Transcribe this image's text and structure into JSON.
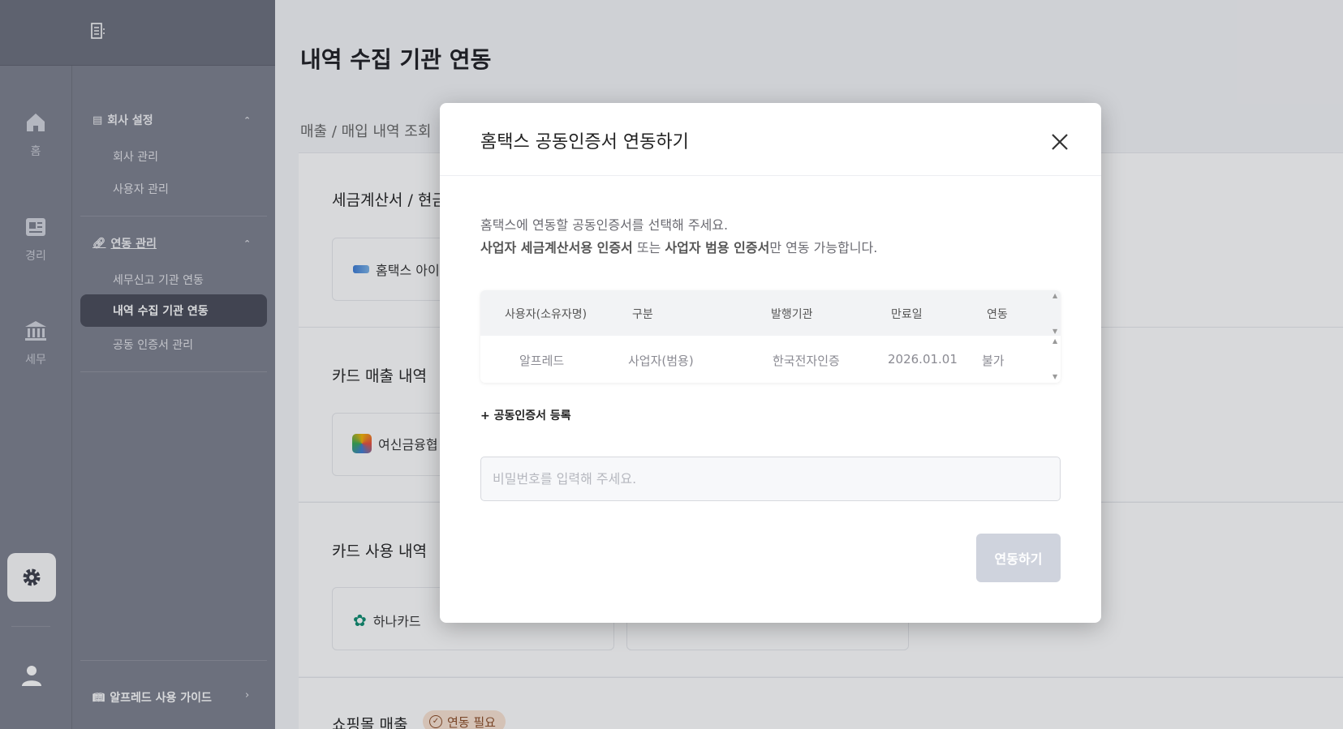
{
  "rail": {
    "items": [
      {
        "label": "홈",
        "icon": "home-icon"
      },
      {
        "label": "경리",
        "icon": "ledger-icon"
      },
      {
        "label": "세무",
        "icon": "bank-icon"
      }
    ]
  },
  "sidebar": {
    "company_section": "회사 설정",
    "company_items": [
      "회사 관리",
      "사용자 관리"
    ],
    "link_section": "연동 관리",
    "link_items": [
      "세무신고 기관 연동",
      "내역 수집 기관 연동",
      "공동 인증서 관리"
    ],
    "guide": "알프레드 사용 가이드"
  },
  "main": {
    "title": "내역 수집 기관 연동",
    "subtitle": "매출 / 매입 내역 조회",
    "sections": [
      {
        "label": "세금계산서 / 현금",
        "vendor": "홈택스 아이"
      },
      {
        "label": "카드 매출 내역",
        "vendor": "여신금융협"
      },
      {
        "label": "카드 사용 내역",
        "vendor": "하나카드"
      },
      {
        "label": "쇼핑몰 매출",
        "badge": "연동 필요"
      }
    ]
  },
  "modal": {
    "title": "홈택스 공동인증서 연동하기",
    "desc_line1": "홈택스에 연동할 공동인증서를 선택해 주세요.",
    "desc_line2_a": "사업자 세금계산서용 인증서",
    "desc_line2_b": " 또는 ",
    "desc_line2_c": "사업자 범용 인증서",
    "desc_line2_d": "만 연동 가능합니다.",
    "table": {
      "headers": [
        "사용자(소유자명)",
        "구분",
        "발행기관",
        "만료일",
        "연동"
      ],
      "rows": [
        [
          "알프레드",
          "사업자(범용)",
          "한국전자인증",
          "2026.01.01",
          "불가"
        ]
      ]
    },
    "add_cert": "+ 공동인증서 등록",
    "password_placeholder": "비밀번호를 입력해 주세요.",
    "connect_button": "연동하기"
  },
  "colors": {
    "sidebar": "#7c7f8d",
    "active_item": "#474a57",
    "button_disabled": "#cfd3dd",
    "badge_bg": "#fbe3d2"
  }
}
